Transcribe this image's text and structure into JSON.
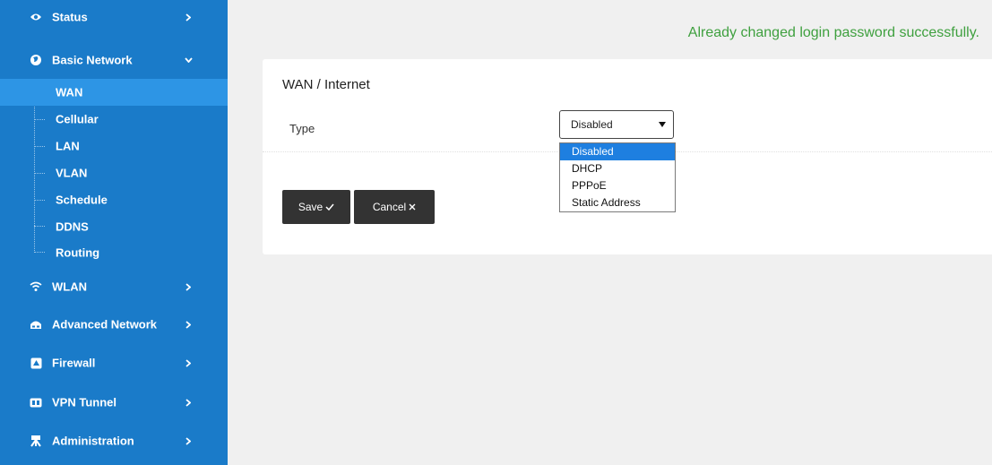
{
  "sidebar": {
    "top_items": [
      {
        "label": "Status",
        "icon": "eye-icon"
      },
      {
        "label": "Basic Network",
        "icon": "globe-icon"
      },
      {
        "label": "WLAN",
        "icon": "wifi-icon"
      },
      {
        "label": "Advanced Network",
        "icon": "network-icon"
      },
      {
        "label": "Firewall",
        "icon": "firewall-icon"
      },
      {
        "label": "VPN Tunnel",
        "icon": "vpn-icon"
      },
      {
        "label": "Administration",
        "icon": "admin-icon"
      }
    ],
    "sub_items": [
      {
        "label": "WAN"
      },
      {
        "label": "Cellular"
      },
      {
        "label": "LAN"
      },
      {
        "label": "VLAN"
      },
      {
        "label": "Schedule"
      },
      {
        "label": "DDNS"
      },
      {
        "label": "Routing"
      }
    ],
    "active_sub_item": "WAN",
    "expanded_item": "Basic Network"
  },
  "main": {
    "success_message": "Already changed login password successfully.",
    "card_title": "WAN / Internet",
    "type_label": "Type",
    "type_value": "Disabled",
    "type_options": [
      "Disabled",
      "DHCP",
      "PPPoE",
      "Static Address"
    ],
    "save_label": "Save",
    "cancel_label": "Cancel"
  },
  "colors": {
    "sidebar_bg": "#1a7bc9",
    "sidebar_active": "#2d95e5",
    "success_text": "#3fa03f",
    "button_bg": "#333333",
    "option_selected": "#1e7fe0"
  }
}
